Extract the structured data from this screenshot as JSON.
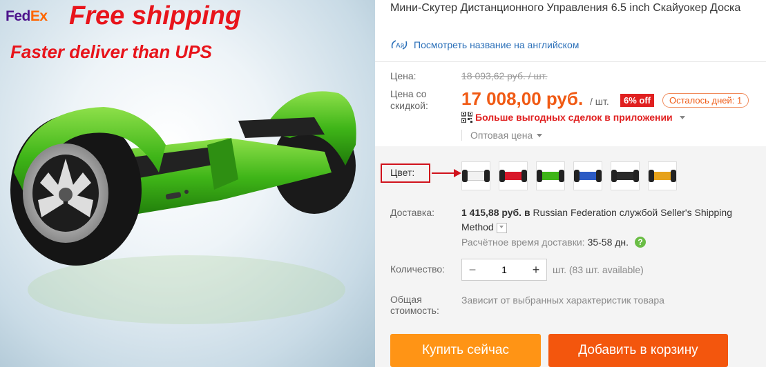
{
  "hero": {
    "logo_fed": "Fed",
    "logo_ex": "Ex",
    "promo_line1": "Free shipping",
    "promo_line2": "Faster deliver than UPS",
    "product_color": "#3fb518"
  },
  "product": {
    "title": "Мини-Скутер Дистанционного Управления 6.5 inch Скайуокер Доска",
    "translate_link": "Посмотреть название на английском"
  },
  "price": {
    "label": "Цена:",
    "old": "18 093,62 руб. / шт.",
    "discount_label": "Цена со скидкой:",
    "new": "17 008,00 руб.",
    "per": "/ шт.",
    "off_badge": "6% off",
    "days_left": "Осталось дней: 1",
    "app_deals": "Больше выгодных сделок в приложении",
    "wholesale": "Оптовая цена"
  },
  "variants": {
    "color_label": "Цвет:",
    "swatches": [
      {
        "name": "white",
        "color": "#f2f2f2"
      },
      {
        "name": "red",
        "color": "#d8182a"
      },
      {
        "name": "green",
        "color": "#3fb518"
      },
      {
        "name": "blue",
        "color": "#2c5bc4"
      },
      {
        "name": "black",
        "color": "#2a2a2a"
      },
      {
        "name": "gold",
        "color": "#e6a21b"
      }
    ]
  },
  "delivery": {
    "label": "Доставка:",
    "cost": "1 415,88 руб.",
    "to_word": "в",
    "destination": "Russian Federation",
    "service_word": "службой",
    "service": "Seller's Shipping Method",
    "eta_label": "Расчётное время доставки:",
    "eta_value": "35-58 дн.",
    "help": "?"
  },
  "quantity": {
    "label": "Количество:",
    "minus": "−",
    "value": "1",
    "plus": "+",
    "stock": "шт. (83 шт. available)"
  },
  "total": {
    "label": "Общая стоимость:",
    "value": "Зависит от выбранных характеристик товара"
  },
  "actions": {
    "buy_now": "Купить сейчас",
    "add_to_cart": "Добавить в корзину"
  }
}
